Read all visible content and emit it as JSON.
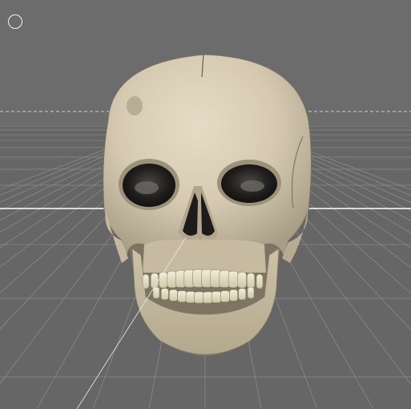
{
  "viewport": {
    "background_color": "#6a6a6a",
    "sky_color": "#6e6e6e",
    "floor_color": "#656565",
    "grid_color": "#8a8a8a",
    "horizon_color": "#ffffff",
    "corner_button_icon": "circle-icon"
  },
  "model": {
    "name": "skull",
    "bone_color": "#d9cfb8",
    "shadow_color": "#8f8671",
    "teeth_color": "#ece7cf",
    "socket_color": "#1b1a18"
  }
}
